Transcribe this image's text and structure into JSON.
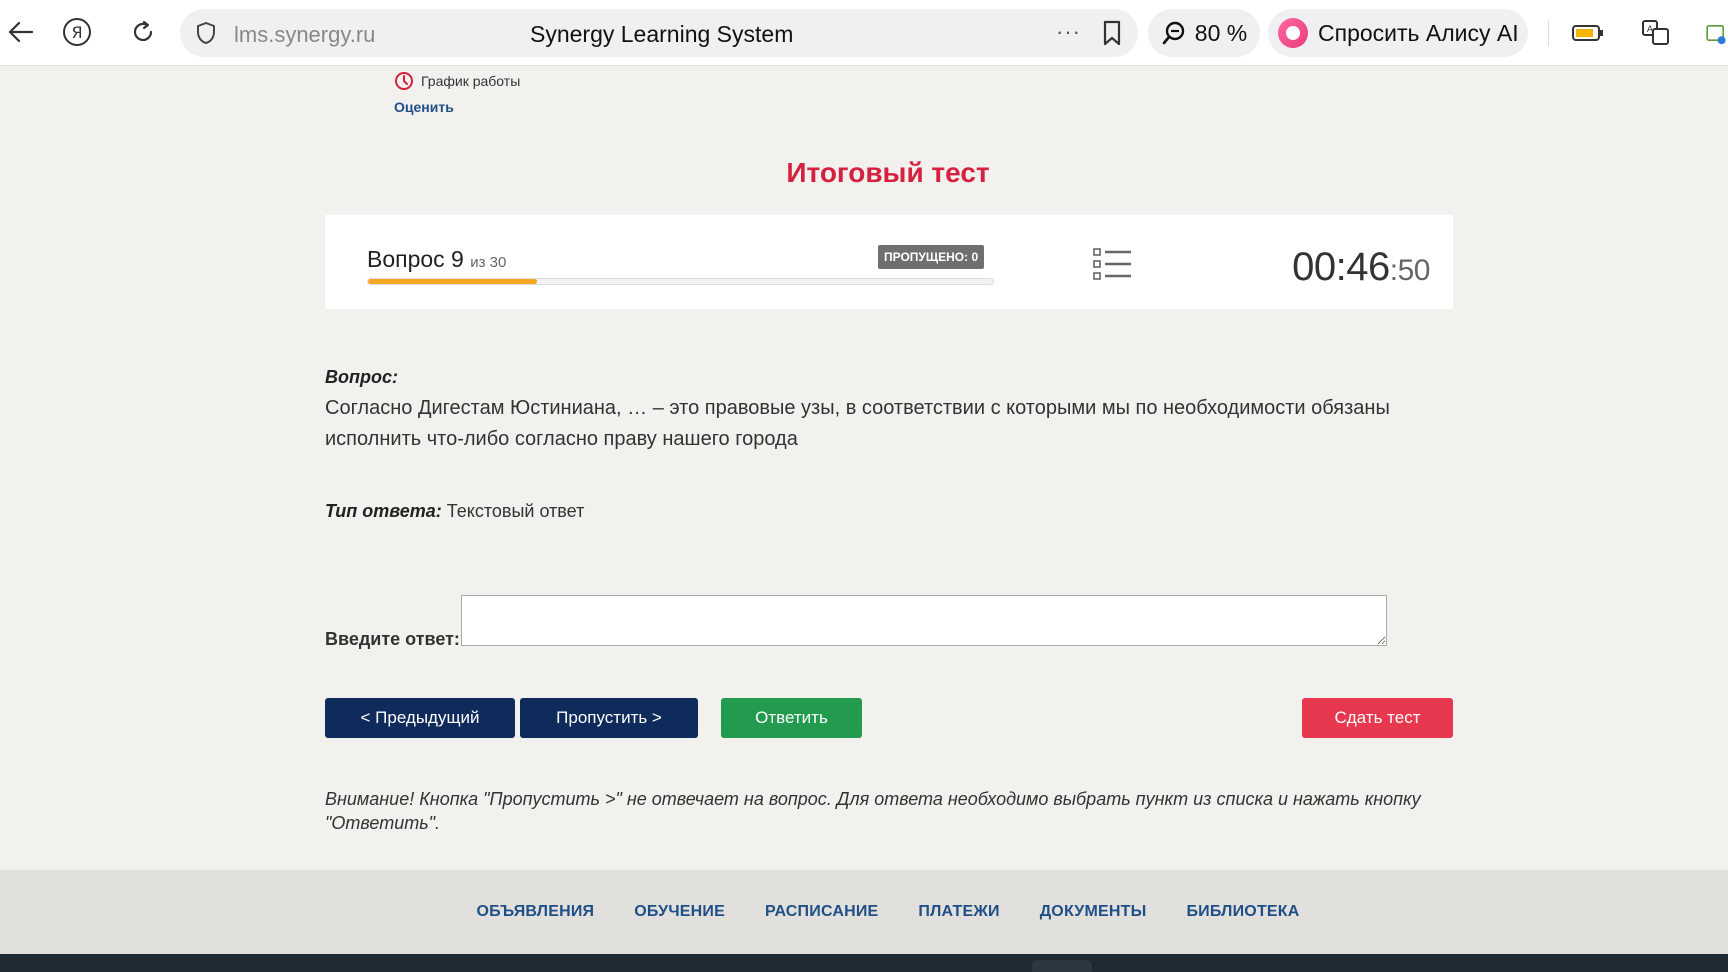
{
  "browser": {
    "url": "lms.synergy.ru",
    "title": "Synergy Learning System",
    "menu_dots": "···",
    "zoom": "80 %",
    "alice_label": "Спросить Алису AI"
  },
  "header": {
    "schedule_label": "График работы",
    "rate_link": "Оценить"
  },
  "page": {
    "title": "Итоговый тест"
  },
  "progress": {
    "question_label": "Вопрос 9",
    "of_label": "из 30",
    "current": 9,
    "total": 30,
    "skipped_badge": "ПРОПУЩЕНО: 0",
    "fill_fraction": 0.27,
    "timer_main": "00:46",
    "timer_sec": ":50"
  },
  "question": {
    "heading": "Вопрос:",
    "text": "Согласно Дигестам Юстиниана, … – это правовые узы, в соответствии с которыми мы по необходимости обязаны исполнить что-либо согласно праву нашего города",
    "answer_type_label": "Тип ответа:",
    "answer_type_value": "Текстовый ответ"
  },
  "answer": {
    "label": "Введите ответ:",
    "value": ""
  },
  "buttons": {
    "prev": "< Предыдущий",
    "skip": "Пропустить >",
    "answer": "Ответить",
    "finish": "Сдать тест"
  },
  "warning": "Внимание! Кнопка \"Пропустить >\" не отвечает на вопрос. Для ответа необходимо выбрать пункт из списка и нажать кнопку \"Ответить\".",
  "footer": {
    "items": [
      "ОБЪЯВЛЕНИЯ",
      "ОБУЧЕНИЕ",
      "РАСПИСАНИЕ",
      "ПЛАТЕЖИ",
      "ДОКУМЕНТЫ",
      "БИБЛИОТЕКА"
    ]
  },
  "colors": {
    "accent_red": "#d6203f",
    "navy": "#0f2b5b",
    "green": "#239b4f",
    "finish_red": "#e8384f",
    "progress_orange": "#f5a623",
    "link_blue": "#1e4f86"
  }
}
